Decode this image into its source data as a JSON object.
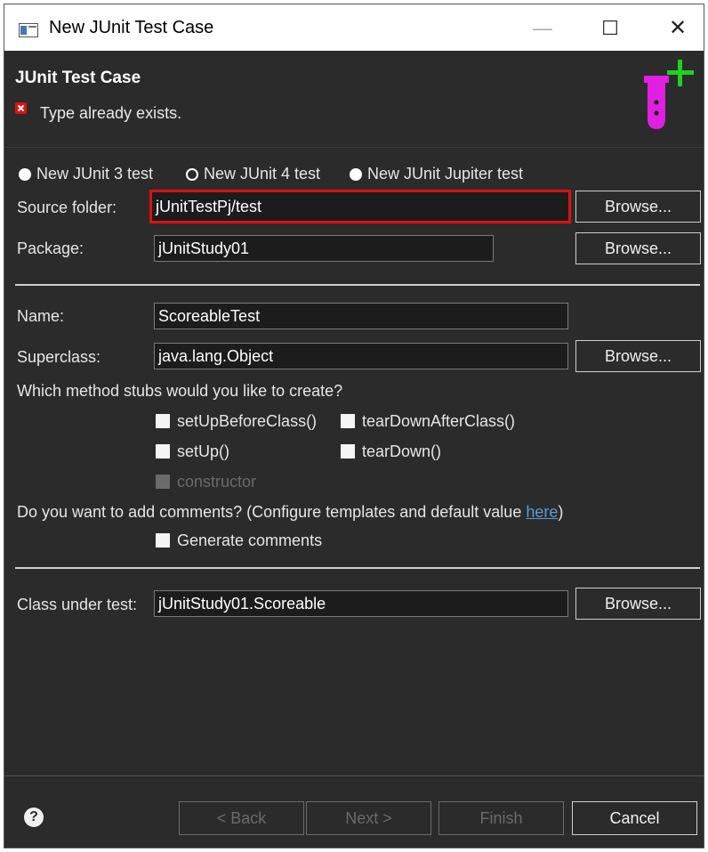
{
  "window": {
    "title": "New JUnit Test Case",
    "controls": {
      "minimize": "—",
      "maximize": "☐",
      "close": "✕"
    }
  },
  "header": {
    "title": "JUnit Test Case",
    "error_message": "Type already exists.",
    "banner_icon": "junit-test-tube-icon"
  },
  "version_radios": [
    {
      "label": "New JUnit 3 test",
      "selected": false
    },
    {
      "label": "New JUnit 4 test",
      "selected": true
    },
    {
      "label": "New JUnit Jupiter test",
      "selected": false
    }
  ],
  "source_folder": {
    "label": "Source folder:",
    "value": "jUnitTestPj/test",
    "browse": "Browse..."
  },
  "package": {
    "label": "Package:",
    "value": "jUnitStudy01",
    "browse": "Browse..."
  },
  "name": {
    "label": "Name:",
    "value": "ScoreableTest"
  },
  "superclass": {
    "label": "Superclass:",
    "value": "java.lang.Object",
    "browse": "Browse..."
  },
  "stubs": {
    "question": "Which method stubs would you like to create?",
    "items": [
      {
        "label": "setUpBeforeClass()",
        "checked": false,
        "enabled": true
      },
      {
        "label": "tearDownAfterClass()",
        "checked": false,
        "enabled": true
      },
      {
        "label": "setUp()",
        "checked": false,
        "enabled": true
      },
      {
        "label": "tearDown()",
        "checked": false,
        "enabled": true
      },
      {
        "label": "constructor",
        "checked": false,
        "enabled": false
      }
    ]
  },
  "comments": {
    "question_prefix": "Do you want to add comments? (Configure templates and default value ",
    "link": "here",
    "question_suffix": ")",
    "checkbox_label": "Generate comments"
  },
  "class_under_test": {
    "label": "Class under test:",
    "value": "jUnitStudy01.Scoreable",
    "browse": "Browse..."
  },
  "footer": {
    "help": "?",
    "back": "< Back",
    "next": "Next >",
    "finish": "Finish",
    "cancel": "Cancel"
  },
  "colors": {
    "background": "#2b2b2b",
    "error": "#e01010",
    "highlight_border": "#e01010",
    "link": "#5a9ad6",
    "banner_tube": "#e020e0",
    "banner_plus": "#20d020"
  }
}
